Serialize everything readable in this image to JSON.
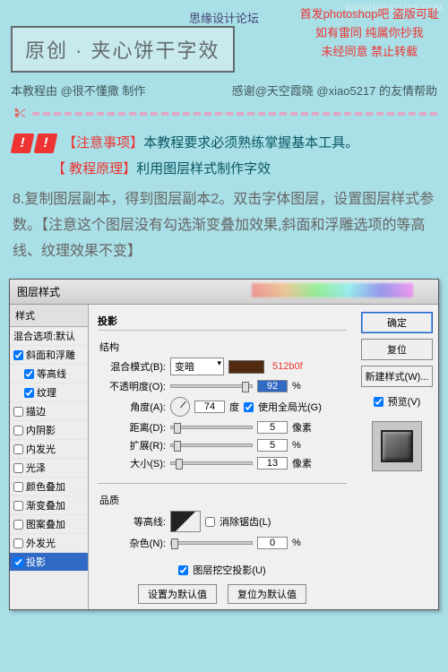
{
  "watermark": "WWW.MISSYUAN.COM",
  "header": {
    "title": "原创 · 夹心饼干字效",
    "source": "思缘设计论坛",
    "r1": "首发photoshop吧",
    "r1b": "盗版可耻",
    "r2": "如有雷同 纯属你抄我",
    "r3": "未经同意 禁止转载"
  },
  "credits": {
    "left": "本教程由 @很不懂撒 制作",
    "right": "感谢@天空霞晓 @xiao5217 的友情帮助"
  },
  "notes": {
    "n1a": "【注意事项】",
    "n1b": "本教程要求必须熟练掌握基本工具。",
    "n2a": "【 教程原理】",
    "n2b": "利用图层样式制作字效"
  },
  "body": {
    "p": "8.复制图层副本，得到图层副本2。双击字体图层，设置图层样式参数。【注意这个图层没有勾选渐变叠加效果,斜面和浮雕选项的等高线、纹理效果不变】"
  },
  "dlg": {
    "title": "图层样式",
    "stylesHeader": "样式",
    "styles": [
      {
        "label": "混合选项:默认",
        "chkVis": false,
        "chk": false,
        "ind": false
      },
      {
        "label": "斜面和浮雕",
        "chkVis": true,
        "chk": true,
        "ind": false
      },
      {
        "label": "等高线",
        "chkVis": true,
        "chk": true,
        "ind": true
      },
      {
        "label": "纹理",
        "chkVis": true,
        "chk": true,
        "ind": true
      },
      {
        "label": "描边",
        "chkVis": true,
        "chk": false,
        "ind": false
      },
      {
        "label": "内阴影",
        "chkVis": true,
        "chk": false,
        "ind": false
      },
      {
        "label": "内发光",
        "chkVis": true,
        "chk": false,
        "ind": false
      },
      {
        "label": "光泽",
        "chkVis": true,
        "chk": false,
        "ind": false
      },
      {
        "label": "颜色叠加",
        "chkVis": true,
        "chk": false,
        "ind": false
      },
      {
        "label": "渐变叠加",
        "chkVis": true,
        "chk": false,
        "ind": false
      },
      {
        "label": "图案叠加",
        "chkVis": true,
        "chk": false,
        "ind": false
      },
      {
        "label": "外发光",
        "chkVis": true,
        "chk": false,
        "ind": false
      },
      {
        "label": "投影",
        "chkVis": true,
        "chk": true,
        "ind": false,
        "sel": true
      }
    ],
    "panel": {
      "title": "投影",
      "g1": "结构",
      "blend": {
        "l": "混合模式(B):",
        "v": "变暗"
      },
      "hex": "512b0f",
      "opacity": {
        "l": "不透明度(O):",
        "v": "92",
        "u": "%",
        "pos": "88%"
      },
      "angle": {
        "l": "角度(A):",
        "v": "74",
        "deg": "度",
        "glob": "使用全局光(G)"
      },
      "dist": {
        "l": "距离(D):",
        "v": "5",
        "u": "像素",
        "pos": "3%"
      },
      "spread": {
        "l": "扩展(R):",
        "v": "5",
        "u": "%",
        "pos": "3%"
      },
      "size": {
        "l": "大小(S):",
        "v": "13",
        "u": "像素",
        "pos": "6%"
      },
      "g2": "品质",
      "contour": {
        "l": "等高线:",
        "anti": "消除锯齿(L)"
      },
      "noise": {
        "l": "杂色(N):",
        "v": "0",
        "u": "%",
        "pos": "0%"
      },
      "knock": "图层挖空投影(U)",
      "b1": "设置为默认值",
      "b2": "复位为默认值"
    },
    "btns": {
      "ok": "确定",
      "cancel": "复位",
      "new": "新建样式(W)...",
      "preview": "预览(V)"
    }
  }
}
